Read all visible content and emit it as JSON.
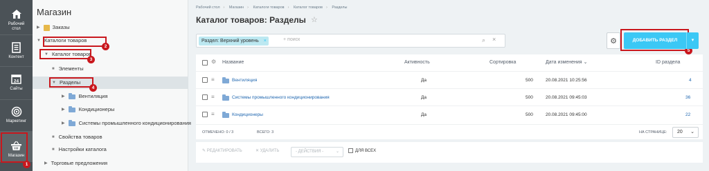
{
  "nav": {
    "items": [
      {
        "label": "Рабочий стол",
        "icon": "home-icon"
      },
      {
        "label": "Контент",
        "icon": "document-icon"
      },
      {
        "label": "Сайты",
        "icon": "calendar-icon"
      },
      {
        "label": "Маркетинг",
        "icon": "target-icon"
      },
      {
        "label": "Магазин",
        "icon": "basket-icon"
      }
    ]
  },
  "tree": {
    "title": "Магазин",
    "items": [
      {
        "label": "Заказы"
      },
      {
        "label": "Каталоги товаров"
      },
      {
        "label": "Каталог товаров"
      },
      {
        "label": "Элементы"
      },
      {
        "label": "Разделы"
      },
      {
        "label": "Вентиляция"
      },
      {
        "label": "Кондиционеры"
      },
      {
        "label": "Системы промышленного кондиционирования"
      },
      {
        "label": "Свойства товаров"
      },
      {
        "label": "Настройки каталога"
      },
      {
        "label": "Торговые предложения"
      }
    ]
  },
  "annotations": [
    "1",
    "2",
    "3",
    "4",
    "5"
  ],
  "breadcrumb": [
    "Рабочий стол",
    "Магазин",
    "Каталоги товаров",
    "Каталог товаров",
    "Разделы"
  ],
  "page_title": "Каталог товаров: Разделы",
  "filter": {
    "chip": "Раздел: Верхний уровень",
    "placeholder": "+ поиск"
  },
  "toolbar": {
    "add_label": "ДОБАВИТЬ РАЗДЕЛ"
  },
  "table": {
    "headers": {
      "name": "Название",
      "active": "Активность",
      "sort": "Сортировка",
      "date": "Дата изменения",
      "id": "ID раздела"
    },
    "rows": [
      {
        "name": "Вентиляция",
        "active": "Да",
        "sort": "500",
        "date": "20.08.2021 10:25:56",
        "id": "4"
      },
      {
        "name": "Системы промышленного кондиционирования",
        "active": "Да",
        "sort": "500",
        "date": "20.08.2021 09:45:03",
        "id": "36"
      },
      {
        "name": "Кондиционеры",
        "active": "Да",
        "sort": "500",
        "date": "20.08.2021 09:45:00",
        "id": "22"
      }
    ]
  },
  "footer": {
    "marked": "ОТМЕЧЕНО: 0 / 3",
    "total": "ВСЕГО: 3",
    "per_page_label": "НА СТРАНИЦЕ:",
    "per_page_value": "20"
  },
  "actions": {
    "edit": "РЕДАКТИРОВАТЬ",
    "delete": "УДАЛИТЬ",
    "select": "- ДЕЙСТВИЯ -",
    "for_all": "ДЛЯ ВСЕХ"
  }
}
